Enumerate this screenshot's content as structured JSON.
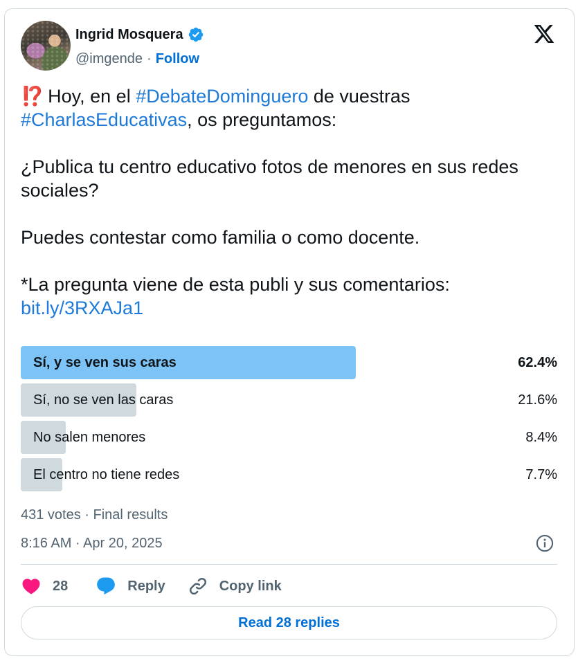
{
  "author": {
    "name": "Ingrid Mosquera",
    "handle": "@imgende",
    "separator": "·",
    "follow_label": "Follow"
  },
  "post": {
    "line1_prefix": "⁉️",
    "line1_text_a": " Hoy, en el ",
    "hashtag1": "#DebateDominguero",
    "line1_text_b": " de vuestras",
    "hashtag2": "#CharlasEducativas",
    "line2_text": ", os preguntamos:",
    "question": "¿Publica tu centro educativo fotos de menores en sus redes sociales?",
    "invite": "Puedes contestar como familia o como docente.",
    "source_note": "*La pregunta viene de esta publi y sus comentarios:",
    "link": "bit.ly/3RXAJa1"
  },
  "poll": {
    "options": [
      {
        "label": "Sí, y se ven sus caras",
        "percent": 62.4,
        "percent_label": "62.4%",
        "winner": true
      },
      {
        "label": "Sí, no se ven las caras",
        "percent": 21.6,
        "percent_label": "21.6%",
        "winner": false
      },
      {
        "label": "No salen menores",
        "percent": 8.4,
        "percent_label": "8.4%",
        "winner": false
      },
      {
        "label": "El centro no tiene redes",
        "percent": 7.7,
        "percent_label": "7.7%",
        "winner": false
      }
    ],
    "meta": "431 votes · Final results"
  },
  "timestamp": "8:16 AM · Apr 20, 2025",
  "actions": {
    "likes_count": "28",
    "reply_label": "Reply",
    "copy_label": "Copy link"
  },
  "read_replies_label": "Read 28 replies",
  "colors": {
    "accent": "#006fd6",
    "hashtag": "#1d7ad8",
    "poll_winner": "#7ec3f5",
    "poll_other": "#cfd9de",
    "like": "#f91880",
    "reply_icon": "#1d9bf0",
    "verified": "#1d9bf0"
  },
  "icons": {
    "verified": "verified-badge-icon",
    "logo": "x-logo-icon",
    "info": "info-icon",
    "like": "heart-icon",
    "reply": "speech-bubble-icon",
    "copy": "link-icon"
  }
}
